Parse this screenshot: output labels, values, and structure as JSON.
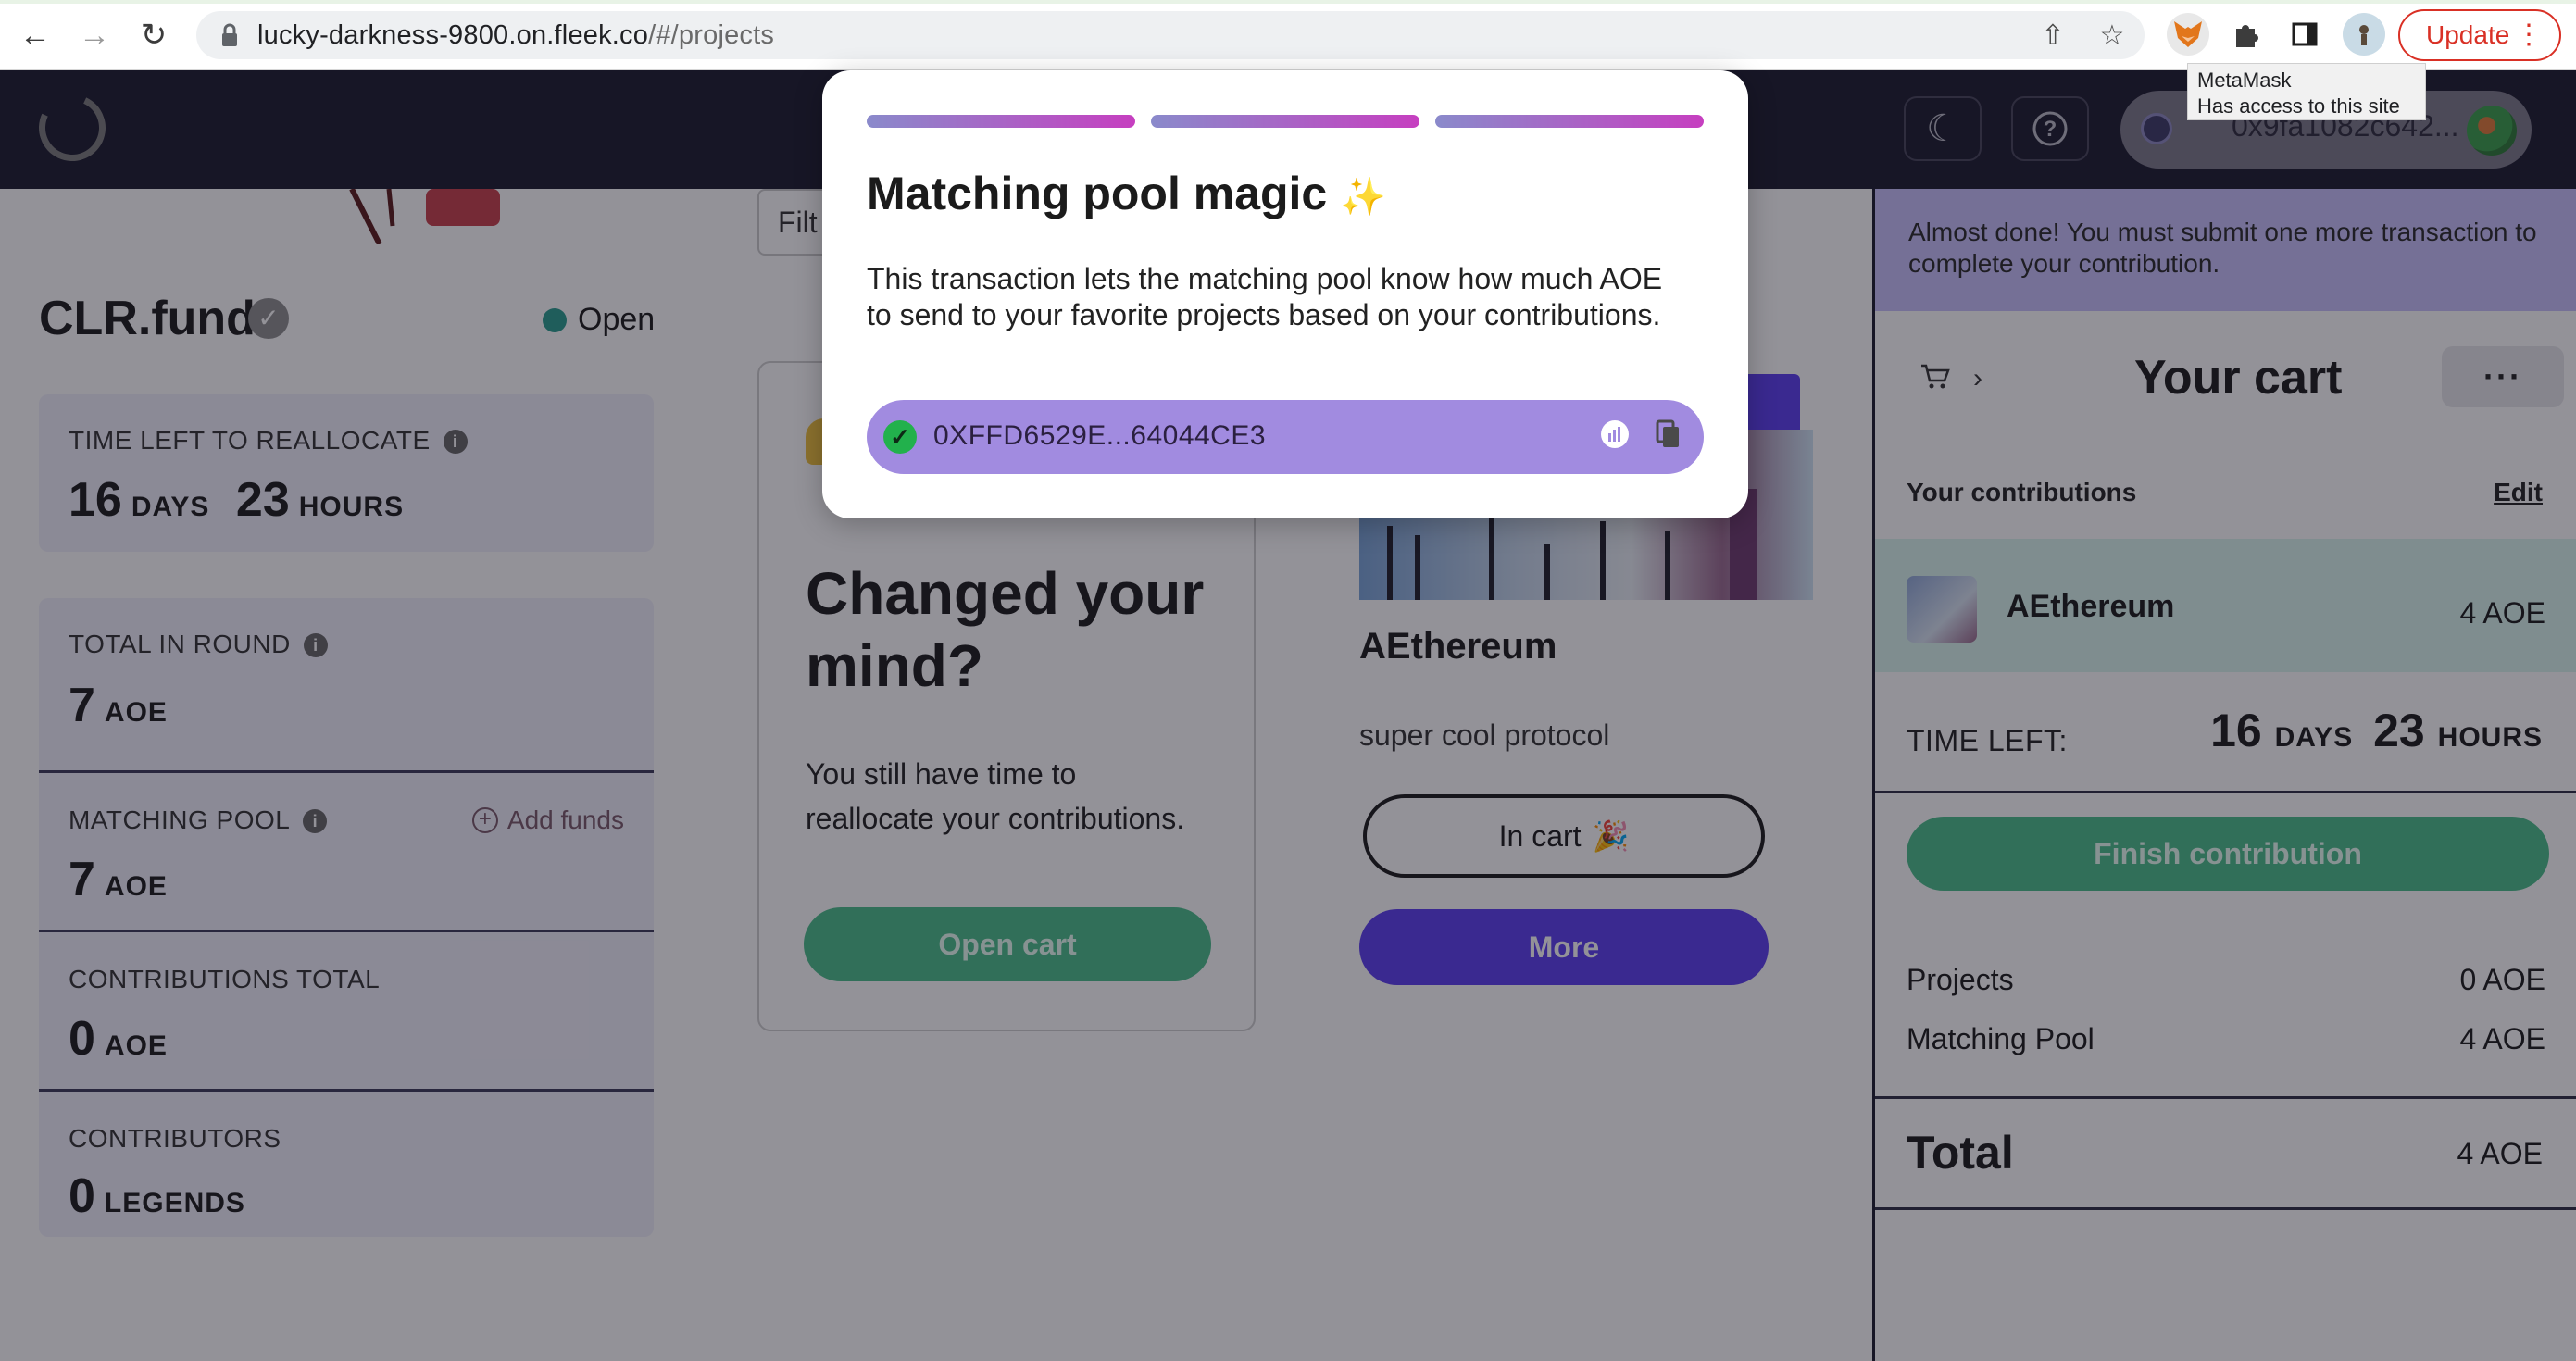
{
  "browser": {
    "url_host": "lucky-darkness-9800.on.fleek.co",
    "url_path": "/#/projects",
    "update_label": "Update",
    "tooltip_title": "MetaMask",
    "tooltip_text": "Has access to this site"
  },
  "header": {
    "wallet_address": "0x9fa1082c642..."
  },
  "sidebar": {
    "fund_name": "CLR.fund",
    "status": "Open",
    "time_left_label": "TIME LEFT TO REALLOCATE",
    "time_days": "16",
    "time_days_unit": "DAYS",
    "time_hours": "23",
    "time_hours_unit": "HOURS",
    "total_label": "TOTAL IN ROUND",
    "total_value": "7",
    "total_unit": "AOE",
    "pool_label": "MATCHING POOL",
    "pool_value": "7",
    "pool_unit": "AOE",
    "add_funds": "Add funds",
    "contrib_label": "CONTRIBUTIONS TOTAL",
    "contrib_value": "0",
    "contrib_unit": "AOE",
    "contributors_label": "CONTRIBUTORS",
    "contributors_value": "0",
    "contributors_unit": "LEGENDS"
  },
  "main": {
    "filter_label": "Filt",
    "card_title": "Changed your mind?",
    "card_text": "You still have time to reallocate your contributions.",
    "open_cart": "Open cart",
    "project_tag": "ng",
    "project_title": "AEthereum",
    "project_desc": "super cool protocol",
    "in_cart": "In cart",
    "in_cart_emoji": "🎉",
    "more": "More"
  },
  "cart": {
    "notice": "Almost done! You must submit one more transaction to complete your contribution.",
    "title": "Your cart",
    "menu": "···",
    "contributions_label": "Your contributions",
    "edit": "Edit",
    "item_name": "AEthereum",
    "item_amount": "4 AOE",
    "time_left_label": "TIME LEFT:",
    "time_days": "16",
    "time_days_unit": "DAYS",
    "time_hours": "23",
    "time_hours_unit": "HOURS",
    "finish": "Finish contribution",
    "projects_label": "Projects",
    "projects_value": "0 AOE",
    "pool_label": "Matching Pool",
    "pool_value": "4 AOE",
    "total_label": "Total",
    "total_value": "4 AOE"
  },
  "modal": {
    "title": "Matching pool magic",
    "title_emoji": "✨",
    "description": "This transaction lets the matching pool know how much AOE to send to your favorite projects based on your contributions.",
    "tx_hash": "0XFFD6529E...64044CE3",
    "steps_done": 3
  },
  "colors": {
    "header_bg": "#1b1a2e",
    "green": "#4bbf8b",
    "purple": "#5b3ef0",
    "notice_bg": "#c8c0fb",
    "tx_bar": "#a18be0"
  }
}
